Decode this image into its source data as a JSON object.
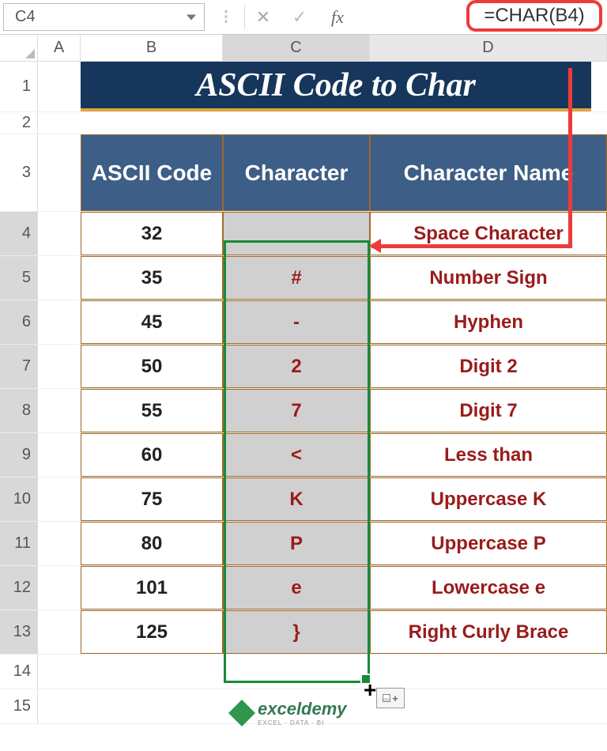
{
  "formula_bar": {
    "name_box": "C4",
    "formula": "=CHAR(B4)"
  },
  "columns": {
    "A": "A",
    "B": "B",
    "C": "C",
    "D": "D"
  },
  "title": "ASCII Code to Char",
  "headers": {
    "code": "ASCII Code",
    "char": "Character",
    "name": "Character Name"
  },
  "rows": [
    {
      "n": "1"
    },
    {
      "n": "2"
    },
    {
      "n": "3"
    },
    {
      "n": "4",
      "code": "32",
      "char": " ",
      "name": "Space Character"
    },
    {
      "n": "5",
      "code": "35",
      "char": "#",
      "name": "Number Sign"
    },
    {
      "n": "6",
      "code": "45",
      "char": "-",
      "name": "Hyphen"
    },
    {
      "n": "7",
      "code": "50",
      "char": "2",
      "name": "Digit 2"
    },
    {
      "n": "8",
      "code": "55",
      "char": "7",
      "name": "Digit 7"
    },
    {
      "n": "9",
      "code": "60",
      "char": "<",
      "name": "Less than"
    },
    {
      "n": "10",
      "code": "75",
      "char": "K",
      "name": "Uppercase K"
    },
    {
      "n": "11",
      "code": "80",
      "char": "P",
      "name": "Uppercase P"
    },
    {
      "n": "12",
      "code": "101",
      "char": "e",
      "name": "Lowercase e"
    },
    {
      "n": "13",
      "code": "125",
      "char": "}",
      "name": "Right Curly Brace"
    },
    {
      "n": "14"
    },
    {
      "n": "15"
    }
  ],
  "watermark": {
    "brand": "exceldemy",
    "tag": "EXCEL · DATA · BI"
  }
}
